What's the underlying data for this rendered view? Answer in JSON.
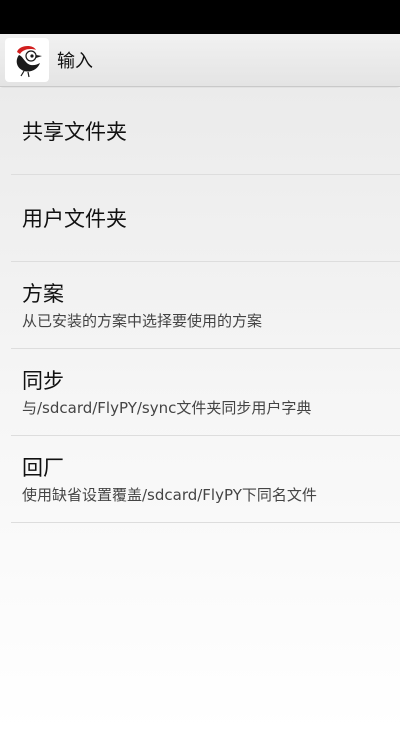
{
  "app": {
    "title": "输入",
    "icon": "bird-logo-icon"
  },
  "preferences": [
    {
      "title": "共享文件夹",
      "summary": ""
    },
    {
      "title": "用户文件夹",
      "summary": ""
    },
    {
      "title": "方案",
      "summary": "从已安装的方案中选择要使用的方案"
    },
    {
      "title": "同步",
      "summary": "与/sdcard/FlyPY/sync文件夹同步用户字典"
    },
    {
      "title": "回厂",
      "summary": "使用缺省设置覆盖/sdcard/FlyPY下同名文件"
    }
  ],
  "colors": {
    "status_bar": "#000000",
    "action_bar": "#e9e9e9",
    "text_primary": "#111111",
    "text_secondary": "#444444",
    "divider": "#dddddd",
    "logo_red": "#d21f1f"
  }
}
